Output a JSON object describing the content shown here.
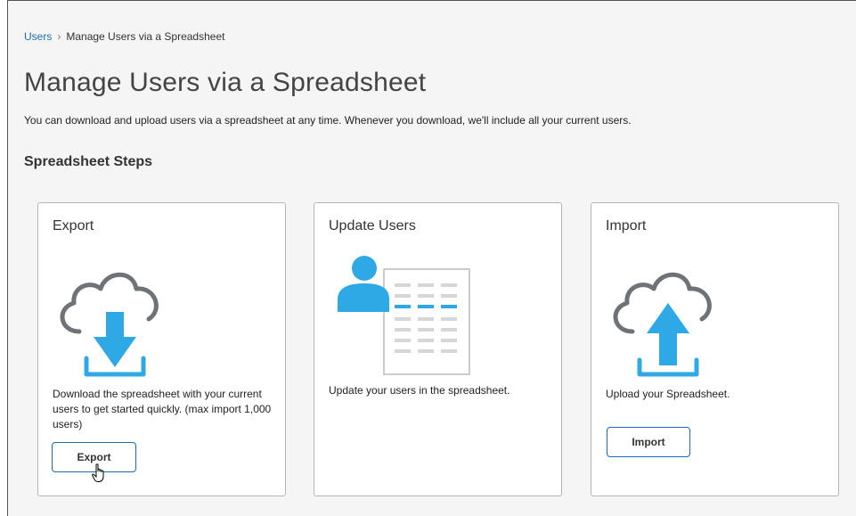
{
  "breadcrumb": {
    "parent": "Users",
    "separator": "›",
    "current": "Manage Users via a Spreadsheet"
  },
  "page_title": "Manage Users via a Spreadsheet",
  "description": "You can download and upload users via a spreadsheet at any time. Whenever you download, we'll include all your current users.",
  "section_title": "Spreadsheet Steps",
  "cards": [
    {
      "title": "Export",
      "icon": "cloud-download-icon",
      "text": "Download the spreadsheet with your current users to get started quickly. (max import 1,000 users)",
      "button_label": "Export"
    },
    {
      "title": "Update Users",
      "icon": "user-spreadsheet-icon",
      "text": "Update your users in the spreadsheet."
    },
    {
      "title": "Import",
      "icon": "cloud-upload-icon",
      "text": "Upload your Spreadsheet.",
      "button_label": "Import"
    }
  ],
  "colors": {
    "accent": "#1a6db5",
    "illustration_blue": "#2fa8e6",
    "illustration_gray": "#6e7378",
    "background": "#f5f5f5"
  }
}
